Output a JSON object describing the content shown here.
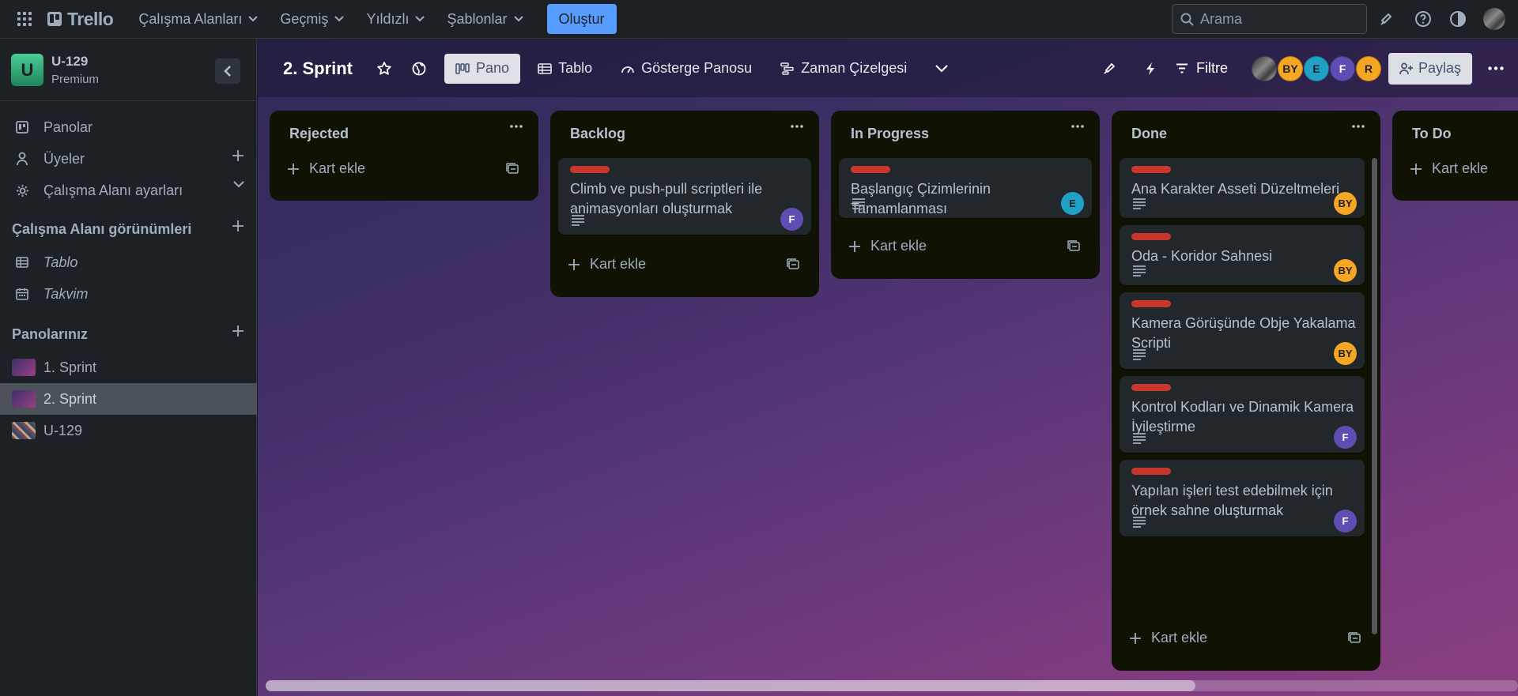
{
  "app": {
    "name": "Trello"
  },
  "topnav": {
    "menus": [
      "Çalışma Alanları",
      "Geçmiş",
      "Yıldızlı",
      "Şablonlar"
    ],
    "create_label": "Oluştur",
    "search_placeholder": "Arama"
  },
  "sidebar": {
    "workspace": {
      "initial": "U",
      "name": "U-129",
      "plan": "Premium"
    },
    "items": [
      "Panolar",
      "Üyeler",
      "Çalışma Alanı ayarları"
    ],
    "views_heading": "Çalışma Alanı görünümleri",
    "views": [
      "Tablo",
      "Takvim"
    ],
    "boards_heading": "Panolarınız",
    "boards": [
      "1. Sprint",
      "2. Sprint",
      "U-129"
    ],
    "active_board": "2. Sprint"
  },
  "board": {
    "title": "2. Sprint",
    "views": [
      "Pano",
      "Tablo",
      "Gösterge Panosu",
      "Zaman Çizelgesi"
    ],
    "filter_label": "Filtre",
    "share_label": "Paylaş",
    "members": [
      {
        "initials": "",
        "color": "photo"
      },
      {
        "initials": "BY",
        "color": "#f5a623"
      },
      {
        "initials": "E",
        "color": "#1fa0c4"
      },
      {
        "initials": "F",
        "color": "#5e4db2"
      },
      {
        "initials": "R",
        "color": "#f5a623"
      }
    ]
  },
  "lists": [
    {
      "title": "Rejected",
      "cards": [],
      "add_label": "Kart ekle"
    },
    {
      "title": "Backlog",
      "add_label": "Kart ekle",
      "cards": [
        {
          "title": "Climb ve push-pull scriptleri ile animasyonları oluşturmak",
          "label_color": "#c9372c",
          "member": "F",
          "member_color": "#5e4db2"
        }
      ]
    },
    {
      "title": "In Progress",
      "add_label": "Kart ekle",
      "cards": [
        {
          "title": "Başlangıç Çizimlerinin Tamamlanması",
          "label_color": "#c9372c",
          "member": "E",
          "member_color": "#1fa0c4"
        }
      ]
    },
    {
      "title": "Done",
      "add_label": "Kart ekle",
      "cards": [
        {
          "title": "Ana Karakter Asseti Düzeltmeleri",
          "label_color": "#c9372c",
          "member": "BY",
          "member_color": "#f5a623"
        },
        {
          "title": "Oda - Koridor Sahnesi",
          "label_color": "#c9372c",
          "member": "BY",
          "member_color": "#f5a623"
        },
        {
          "title": "Kamera Görüşünde Obje Yakalama Scripti",
          "label_color": "#c9372c",
          "member": "BY",
          "member_color": "#f5a623"
        },
        {
          "title": "Kontrol Kodları ve Dinamik Kamera İyileştirme",
          "label_color": "#c9372c",
          "member": "F",
          "member_color": "#5e4db2"
        },
        {
          "title": "Yapılan işleri test edebilmek için örnek sahne oluşturmak",
          "label_color": "#c9372c",
          "member": "F",
          "member_color": "#5e4db2"
        }
      ]
    },
    {
      "title": "To Do",
      "cards": [],
      "add_label": "Kart ekle"
    }
  ],
  "colors": {
    "accent": "#579dff",
    "label_red": "#c9372c",
    "list_bg": "#101204",
    "card_bg": "#22272b"
  }
}
